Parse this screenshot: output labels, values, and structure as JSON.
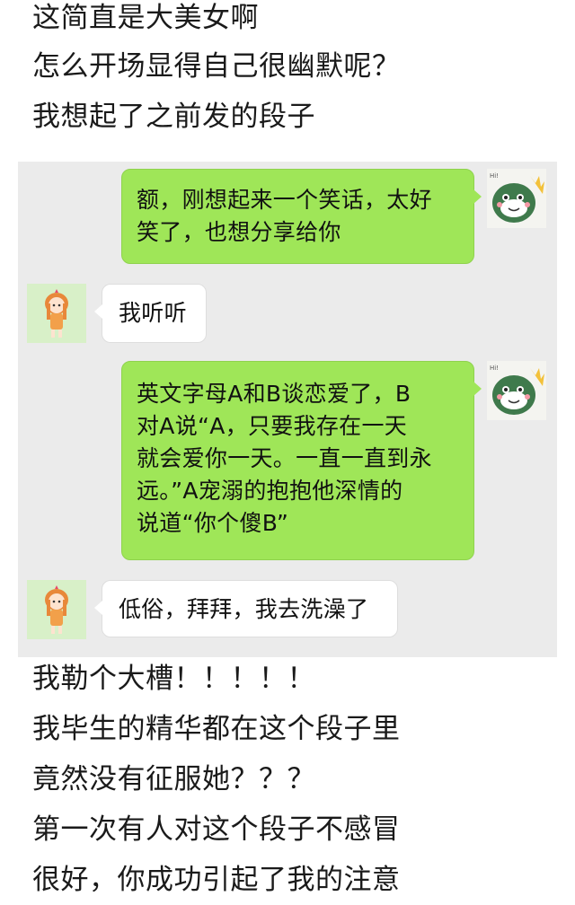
{
  "caption_top": [
    "这简直是大美女啊",
    "怎么开场显得自己很幽默呢？",
    "我想起了之前发的段子"
  ],
  "chat": {
    "messages": [
      {
        "from": "me",
        "lines": [
          "额，刚想起来一个笑话，太好",
          "笑了，也想分享给你"
        ]
      },
      {
        "from": "her",
        "lines": [
          "我听听"
        ]
      },
      {
        "from": "me",
        "lines": [
          "英文字母A和B谈恋爱了，B",
          "对A说“A，只要我存在一天",
          "就会爱你一天。一直一直到永",
          "远。”A宠溺的抱抱他深情的",
          "说道“你个傻B”"
        ]
      },
      {
        "from": "her",
        "lines": [
          "低俗，拜拜，我去洗澡了"
        ]
      }
    ],
    "colors": {
      "panel_bg": "#ebebeb",
      "sent_bubble": "#9fe658",
      "received_bubble": "#ffffff"
    },
    "avatar_icons": {
      "me": "green-dinosaur-avatar-icon",
      "her": "cartoon-girl-avatar-icon"
    }
  },
  "caption_bottom": [
    "我勒个大槽！！！！！",
    "我毕生的精华都在这个段子里",
    "竟然没有征服她？？？",
    "第一次有人对这个段子不感冒",
    "很好，你成功引起了我的注意"
  ]
}
